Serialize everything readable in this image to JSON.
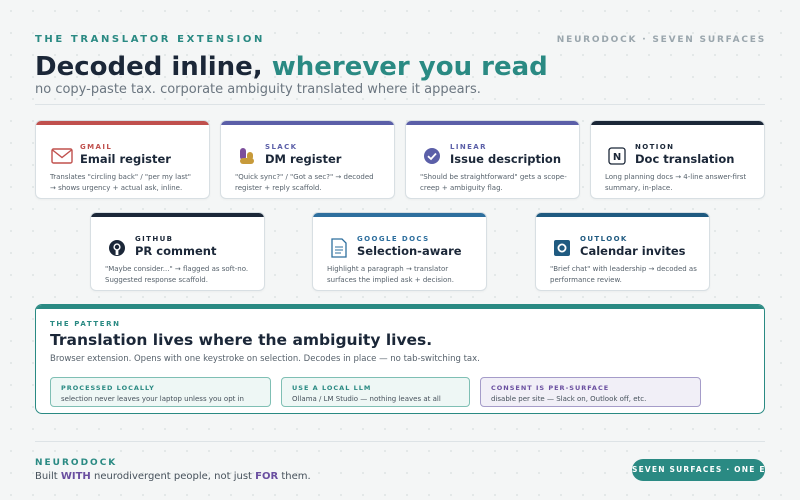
{
  "header": {
    "eyebrow": "THE TRANSLATOR EXTENSION",
    "brand": "NEURODOCK · SEVEN SURFACES",
    "title_main": "Decoded inline, ",
    "title_accent": "wherever you read",
    "subtitle": "no copy-paste tax. corporate ambiguity translated where it appears."
  },
  "cards": [
    {
      "label": "GMAIL",
      "name": "Email register",
      "desc": "Translates \"circling back\" / \"per my last\" → shows urgency + actual ask, inline.",
      "color": "#c0504d",
      "icon": "mail-icon"
    },
    {
      "label": "SLACK",
      "name": "DM register",
      "desc": "\"Quick sync?\" / \"Got a sec?\" → decoded register + reply scaffold.",
      "color": "#5b5fa8",
      "icon": "slack-icon"
    },
    {
      "label": "LINEAR",
      "name": "Issue description",
      "desc": "\"Should be straightforward\" gets a scope-creep + ambiguity flag.",
      "color": "#5b5fa8",
      "icon": "check-circle-icon"
    },
    {
      "label": "NOTION",
      "name": "Doc translation",
      "desc": "Long planning docs → 4-line answer-first summary, in-place.",
      "color": "#1b2738",
      "icon": "notion-icon"
    },
    {
      "label": "GITHUB",
      "name": "PR comment",
      "desc": "\"Maybe consider...\" → flagged as soft-no. Suggested response scaffold.",
      "color": "#1b2738",
      "icon": "github-icon"
    },
    {
      "label": "GOOGLE DOCS",
      "name": "Selection-aware",
      "desc": "Highlight a paragraph → translator surfaces the implied ask + decision.",
      "color": "#2e6f9e",
      "icon": "document-icon"
    },
    {
      "label": "OUTLOOK",
      "name": "Calendar invites",
      "desc": "\"Brief chat\" with leadership → decoded as performance review.",
      "color": "#1f5a80",
      "icon": "outlook-icon"
    }
  ],
  "pattern": {
    "eyebrow": "THE PATTERN",
    "title": "Translation lives where the ambiguity lives.",
    "desc": "Browser extension. Opens with one keystroke on selection. Decodes in place — no tab-switching tax.",
    "chips": [
      {
        "label": "PROCESSED LOCALLY",
        "text": "selection never leaves your laptop unless you opt in"
      },
      {
        "label": "USE A LOCAL LLM",
        "text": "Ollama / LM Studio — nothing leaves at all"
      },
      {
        "label": "CONSENT IS PER-SURFACE",
        "text": "disable per site — Slack on, Outlook off, etc."
      }
    ]
  },
  "footer": {
    "brand": "NEURODOCK",
    "tag_1": "Built ",
    "tag_with": "WITH",
    "tag_2": " neurodivergent people, not just ",
    "tag_for": "FOR",
    "tag_3": " them.",
    "pill": "SEVEN SURFACES · ONE EXT"
  },
  "colors": {
    "accent": "#2a8a83",
    "dark": "#1b2738",
    "purple": "#6a4fa0"
  }
}
